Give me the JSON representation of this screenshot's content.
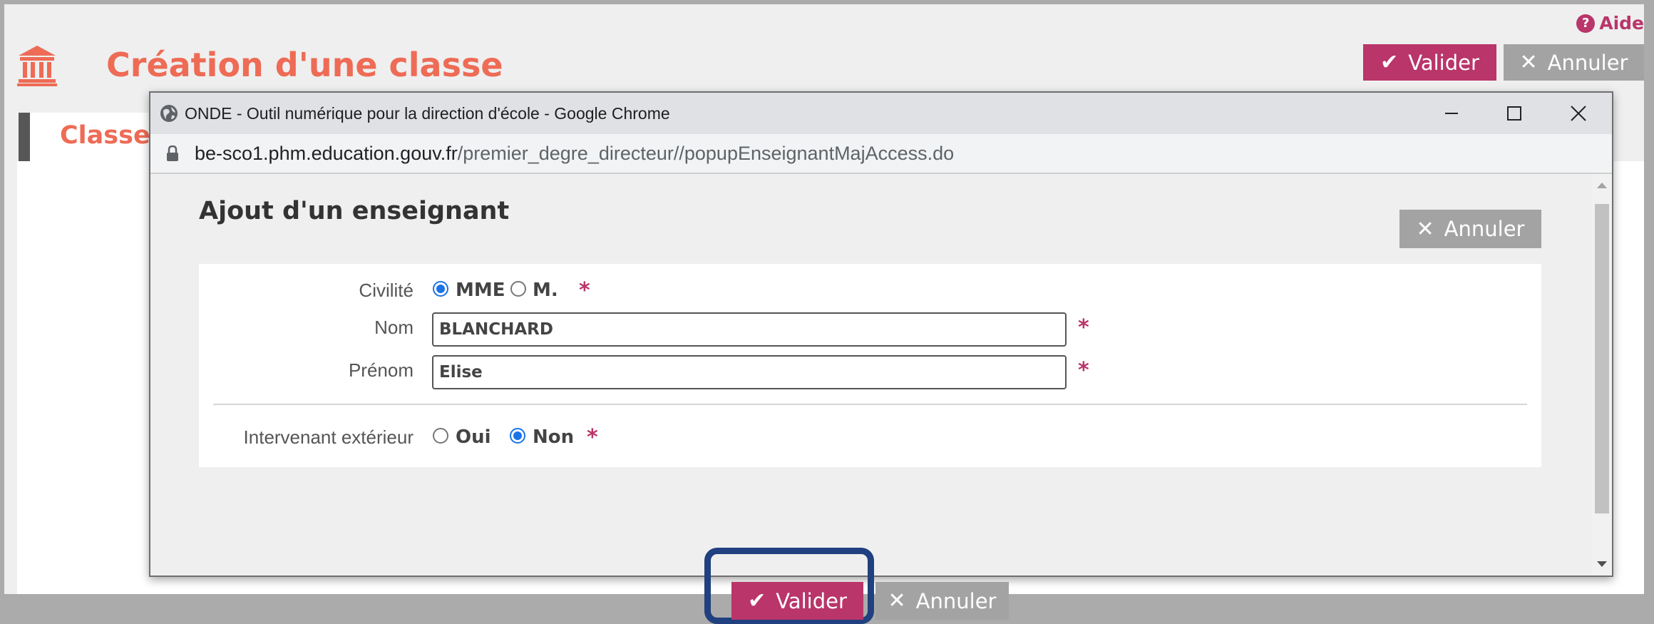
{
  "help": {
    "label": "Aide",
    "icon": "?"
  },
  "page": {
    "title": "Création d'une classe",
    "section_tab": "Classe"
  },
  "toolbar": {
    "valider": "Valider",
    "annuler": "Annuler"
  },
  "icons": {
    "check": "✔",
    "close": "✕"
  },
  "popup": {
    "window_title": "ONDE - Outil numérique pour la direction d'école - Google Chrome",
    "url_host": "be-sco1.phm.education.gouv.fr",
    "url_path": "/premier_degre_directeur//popupEnseignantMajAccess.do",
    "heading": "Ajout d'un enseignant",
    "annuler_top": "Annuler",
    "form": {
      "civilite_label": "Civilité",
      "civilite_options": [
        "MME",
        "M."
      ],
      "civilite_selected": "MME",
      "nom_label": "Nom",
      "nom_value": "BLANCHARD",
      "prenom_label": "Prénom",
      "prenom_value": "Elise",
      "intervenant_label": "Intervenant extérieur",
      "intervenant_options": [
        "Oui",
        "Non"
      ],
      "intervenant_selected": "Non",
      "required_mark": "*"
    },
    "valider": "Valider",
    "annuler": "Annuler"
  },
  "colors": {
    "accent": "#b9356a",
    "title": "#ee6b55",
    "highlight": "#20407f"
  }
}
